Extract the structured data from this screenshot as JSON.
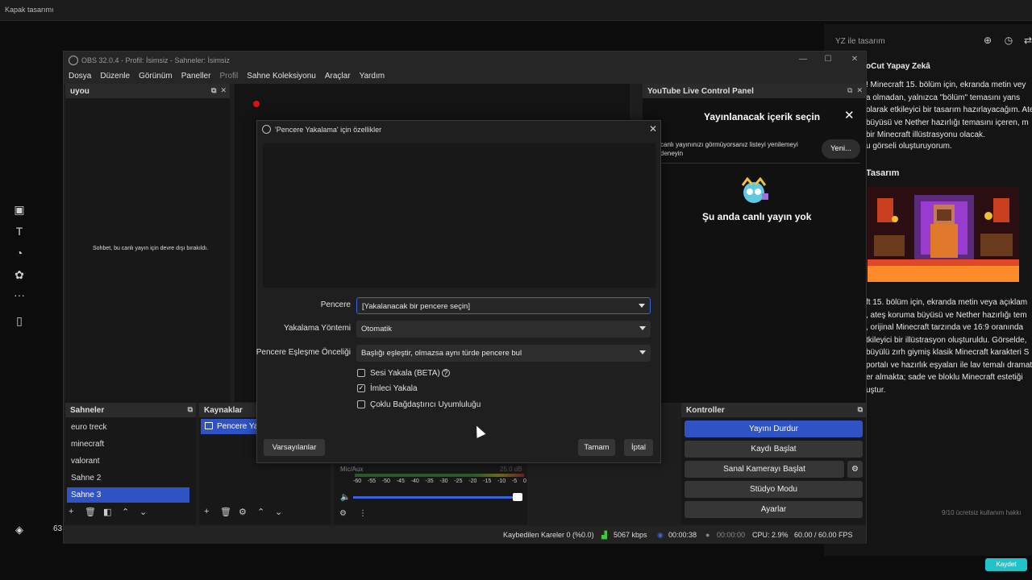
{
  "host": {
    "title": "Kapak tasarımı"
  },
  "left_tools": [
    "image-icon",
    "text-icon",
    "shape-icon",
    "sticker-icon",
    "more-icon",
    "video-icon"
  ],
  "right_panel": {
    "title": "YZ ile tasarım",
    "heading": "oCut Yapay Zekâ",
    "para1": [
      "! Minecraft 15. bölüm için, ekranda metin vey",
      "a olmadan, yalnızca  \"bölüm\"  temasını yans",
      "olarak etkileyici bir tasarım hazırlayacağım. Ate",
      " büyüsü ve Nether hazırlığı temasını içeren, m",
      " bir Minecraft illüstrasyonu olacak."
    ],
    "para2": "u görseli oluşturuyorum.",
    "heading2": "Tasarım",
    "para3": [
      "ft 15. bölüm için, ekranda metin veya açıklam",
      ", ateş koruma büyüsü ve Nether hazırlığı tem",
      ", orijinal Minecraft tarzında ve 16:9 oranında",
      "tkileyici bir illüstrasyon oluşturuldu. Görselde,",
      "büyülü zırh giymiş klasik Minecraft karakteri S",
      "portalı ve hazırlık eşyaları ile lav temalı dramat",
      "er almakta; sade ve bloklu Minecraft estetiği",
      "uştur."
    ],
    "usage": "9/10 ücretsiz kullanım hakkı"
  },
  "bottom": {
    "count": "63",
    "save_label": "Kaydet"
  },
  "obs": {
    "title": "OBS 32.0.4 - Profil: İsimsiz - Sahneler: İsimsiz",
    "menu": [
      "Dosya",
      "Düzenle",
      "Görünüm",
      "Paneller",
      "Profil",
      "Sahne Koleksiyonu",
      "Araçlar",
      "Yardım"
    ],
    "chat_dock_title": "uyou",
    "chat_message": "Sohbet, bu canlı yayın için devre dışı bırakıldı.",
    "yt": {
      "title": "YouTube Live Control Panel",
      "subtitle": "Yayınlanacak içerik seçin",
      "refresh_text": "canlı yayınınızı görmüyorsanız listeyi yenilemeyi\ndeneyin",
      "new_label": "Yeni...",
      "no_live": "Şu anda canlı yayın yok"
    },
    "scenes_title": "Sahneler",
    "scenes": [
      "euro treck",
      "minecraft",
      "valorant",
      "Sahne 2",
      "Sahne 3"
    ],
    "active_scene": 4,
    "sources_title": "Kaynaklar",
    "source_item": "Pencere Yak",
    "mixer": {
      "label": "Mic/Aux",
      "level": "25.0 dB",
      "scale": [
        "-60",
        "-55",
        "-50",
        "-45",
        "-40",
        "-35",
        "-30",
        "-25",
        "-20",
        "-15",
        "-10",
        "-5",
        "0"
      ]
    },
    "controls_title": "Kontroller",
    "controls": [
      "Yayını Durdur",
      "Kaydı Başlat",
      "Sanal Kamerayı Başlat",
      "Stüdyo Modu",
      "Ayarlar"
    ],
    "status": {
      "dropped": "Kaybedilen Kareler 0 (%0.0)",
      "bitrate": "5067 kbps",
      "live_time": "00:00:38",
      "rec_time": "00:00:00",
      "cpu": "CPU: 2.9%",
      "fps": "60.00 / 60.00 FPS"
    }
  },
  "dialog": {
    "title": "'Pencere Yakalama' için özellikler",
    "window_label": "Pencere",
    "window_value": "[Yakalanacak bir pencere seçin]",
    "method_label": "Yakalama Yöntemi",
    "method_value": "Otomatik",
    "priority_label": "Pencere Eşleşme Önceliği",
    "priority_value": "Başlığı eşleştir, olmazsa aynı türde pencere bul",
    "capture_audio": "Sesi Yakala (BETA)",
    "capture_cursor": "İmleci Yakala",
    "multi_adapter": "Çoklu Bağdaştırıcı Uyumluluğu",
    "capture_audio_checked": false,
    "capture_cursor_checked": true,
    "multi_adapter_checked": false,
    "defaults_label": "Varsayılanlar",
    "ok_label": "Tamam",
    "cancel_label": "İptal"
  },
  "colors": {
    "accent": "#2f52c4",
    "save": "#21c3c8",
    "red_marker": "#e01010"
  }
}
